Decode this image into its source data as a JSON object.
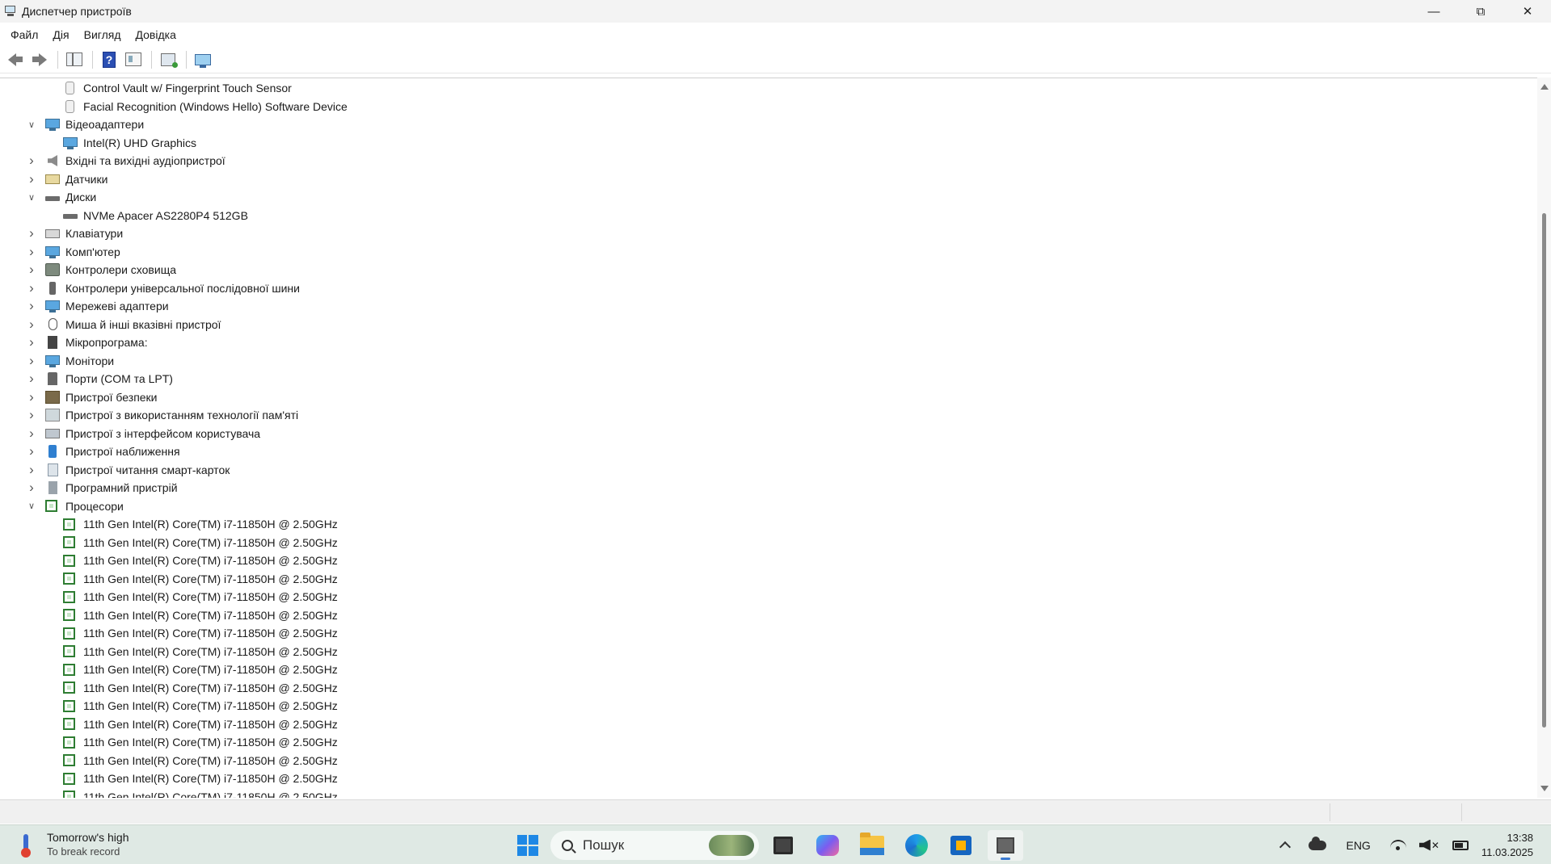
{
  "window": {
    "title": "Диспетчер пристроїв"
  },
  "menu": [
    "Файл",
    "Дія",
    "Вигляд",
    "Довідка"
  ],
  "toolbar": {
    "icons": [
      "back-icon",
      "forward-icon",
      "show-hide-tree-icon",
      "help-icon",
      "properties-icon",
      "scan-hardware-icon",
      "monitor-icon"
    ]
  },
  "tree": [
    {
      "level": 2,
      "icon": "bio",
      "label": "Control Vault w/ Fingerprint Touch Sensor",
      "expander": "none"
    },
    {
      "level": 2,
      "icon": "bio",
      "label": "Facial Recognition (Windows Hello) Software Device",
      "expander": "none"
    },
    {
      "level": 1,
      "icon": "monitor",
      "label": "Відеоадаптери",
      "expander": "expanded"
    },
    {
      "level": 2,
      "icon": "monitor",
      "label": "Intel(R) UHD Graphics",
      "expander": "none"
    },
    {
      "level": 1,
      "icon": "speaker",
      "label": "Вхідні та вихідні аудіопристрої",
      "expander": "collapsed"
    },
    {
      "level": 1,
      "icon": "sensor",
      "label": "Датчики",
      "expander": "collapsed"
    },
    {
      "level": 1,
      "icon": "disk",
      "label": "Диски",
      "expander": "expanded"
    },
    {
      "level": 2,
      "icon": "disk",
      "label": "NVMe Apacer AS2280P4 512GB",
      "expander": "none"
    },
    {
      "level": 1,
      "icon": "keyboard",
      "label": "Клавіатури",
      "expander": "collapsed"
    },
    {
      "level": 1,
      "icon": "monitor",
      "label": "Комп'ютер",
      "expander": "collapsed"
    },
    {
      "level": 1,
      "icon": "storage",
      "label": "Контролери сховища",
      "expander": "collapsed"
    },
    {
      "level": 1,
      "icon": "usb",
      "label": "Контролери універсальної послідовної шини",
      "expander": "collapsed"
    },
    {
      "level": 1,
      "icon": "monitor",
      "label": "Мережеві адаптери",
      "expander": "collapsed"
    },
    {
      "level": 1,
      "icon": "mouse",
      "label": "Миша й інші вказівні пристрої",
      "expander": "collapsed"
    },
    {
      "level": 1,
      "icon": "firm",
      "label": "Мікропрограма:",
      "expander": "collapsed"
    },
    {
      "level": 1,
      "icon": "monitor",
      "label": "Монітори",
      "expander": "collapsed"
    },
    {
      "level": 1,
      "icon": "port",
      "label": "Порти (COM та LPT)",
      "expander": "collapsed"
    },
    {
      "level": 1,
      "icon": "sec",
      "label": "Пристрої безпеки",
      "expander": "collapsed"
    },
    {
      "level": 1,
      "icon": "gray",
      "label": "Пристрої з використанням технології пам'яті",
      "expander": "collapsed"
    },
    {
      "level": 1,
      "icon": "hid",
      "label": "Пристрої з інтерфейсом користувача",
      "expander": "collapsed"
    },
    {
      "level": 1,
      "icon": "prox",
      "label": "Пристрої наближення",
      "expander": "collapsed"
    },
    {
      "level": 1,
      "icon": "smart",
      "label": "Пристрої читання смарт-карток",
      "expander": "collapsed"
    },
    {
      "level": 1,
      "icon": "soft",
      "label": "Програмний пристрій",
      "expander": "collapsed"
    },
    {
      "level": 1,
      "icon": "chip",
      "label": "Процесори",
      "expander": "expanded"
    },
    {
      "level": 2,
      "icon": "chip",
      "label": "11th Gen Intel(R) Core(TM) i7-11850H @ 2.50GHz",
      "expander": "none"
    },
    {
      "level": 2,
      "icon": "chip",
      "label": "11th Gen Intel(R) Core(TM) i7-11850H @ 2.50GHz",
      "expander": "none"
    },
    {
      "level": 2,
      "icon": "chip",
      "label": "11th Gen Intel(R) Core(TM) i7-11850H @ 2.50GHz",
      "expander": "none"
    },
    {
      "level": 2,
      "icon": "chip",
      "label": "11th Gen Intel(R) Core(TM) i7-11850H @ 2.50GHz",
      "expander": "none"
    },
    {
      "level": 2,
      "icon": "chip",
      "label": "11th Gen Intel(R) Core(TM) i7-11850H @ 2.50GHz",
      "expander": "none"
    },
    {
      "level": 2,
      "icon": "chip",
      "label": "11th Gen Intel(R) Core(TM) i7-11850H @ 2.50GHz",
      "expander": "none"
    },
    {
      "level": 2,
      "icon": "chip",
      "label": "11th Gen Intel(R) Core(TM) i7-11850H @ 2.50GHz",
      "expander": "none"
    },
    {
      "level": 2,
      "icon": "chip",
      "label": "11th Gen Intel(R) Core(TM) i7-11850H @ 2.50GHz",
      "expander": "none"
    },
    {
      "level": 2,
      "icon": "chip",
      "label": "11th Gen Intel(R) Core(TM) i7-11850H @ 2.50GHz",
      "expander": "none"
    },
    {
      "level": 2,
      "icon": "chip",
      "label": "11th Gen Intel(R) Core(TM) i7-11850H @ 2.50GHz",
      "expander": "none"
    },
    {
      "level": 2,
      "icon": "chip",
      "label": "11th Gen Intel(R) Core(TM) i7-11850H @ 2.50GHz",
      "expander": "none"
    },
    {
      "level": 2,
      "icon": "chip",
      "label": "11th Gen Intel(R) Core(TM) i7-11850H @ 2.50GHz",
      "expander": "none"
    },
    {
      "level": 2,
      "icon": "chip",
      "label": "11th Gen Intel(R) Core(TM) i7-11850H @ 2.50GHz",
      "expander": "none"
    },
    {
      "level": 2,
      "icon": "chip",
      "label": "11th Gen Intel(R) Core(TM) i7-11850H @ 2.50GHz",
      "expander": "none"
    },
    {
      "level": 2,
      "icon": "chip",
      "label": "11th Gen Intel(R) Core(TM) i7-11850H @ 2.50GHz",
      "expander": "none"
    },
    {
      "level": 2,
      "icon": "chip",
      "label": "11th Gen Intel(R) Core(TM) i7-11850H @ 2.50GHz",
      "expander": "none"
    }
  ],
  "taskbar": {
    "weather_title": "Tomorrow's high",
    "weather_sub": "To break record",
    "search_placeholder": "Пошук",
    "apps": [
      "task-view",
      "copilot",
      "file-explorer",
      "edge",
      "microsoft-store",
      "device-manager"
    ],
    "language": "ENG",
    "time": "13:38",
    "date": "11.03.2025"
  },
  "colors": {
    "accent": "#1e88e5",
    "processor_icon": "#2e7d32",
    "taskbar_bg": "#dfe9e4"
  }
}
